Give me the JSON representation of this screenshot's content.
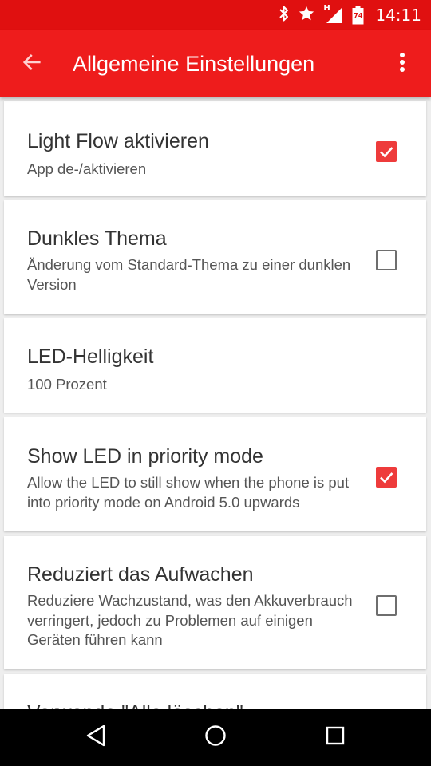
{
  "status_bar": {
    "time": "14:11",
    "battery_level": "74",
    "network_type": "H",
    "icons": [
      "bluetooth-icon",
      "star-icon",
      "signal-icon",
      "battery-icon"
    ]
  },
  "app_bar": {
    "title": "Allgemeine Einstellungen",
    "back_icon": "arrow-back-icon",
    "overflow_icon": "more-vert-icon"
  },
  "settings": [
    {
      "title": "Light Flow aktivieren",
      "summary": "App de-/aktivieren",
      "checkbox": true,
      "checked": true
    },
    {
      "title": "Dunkles Thema",
      "summary": "Änderung vom Standard-Thema zu einer dunklen Version",
      "checkbox": true,
      "checked": false
    },
    {
      "title": "LED-Helligkeit",
      "summary": "100 Prozent",
      "checkbox": false
    },
    {
      "title": "Show LED in priority mode",
      "summary": "Allow the LED to still show when the phone is put into priority mode on Android 5.0 upwards",
      "checkbox": true,
      "checked": true
    },
    {
      "title": "Reduziert das Aufwachen",
      "summary": "Reduziere Wachzustand, was den Akkuverbrauch verringert, jedoch zu Problemen auf einigen Geräten führen kann",
      "checkbox": true,
      "checked": false
    },
    {
      "title": "Verwende \"Alle löschen\"",
      "summary": "",
      "checkbox": false
    }
  ],
  "colors": {
    "status_bar": "#e01010",
    "app_bar": "#ee1c1c",
    "accent": "#ee3b3b",
    "background": "#eeeeee"
  },
  "nav_bar": {
    "icons": [
      "back-triangle-icon",
      "home-circle-icon",
      "recents-square-icon"
    ]
  }
}
